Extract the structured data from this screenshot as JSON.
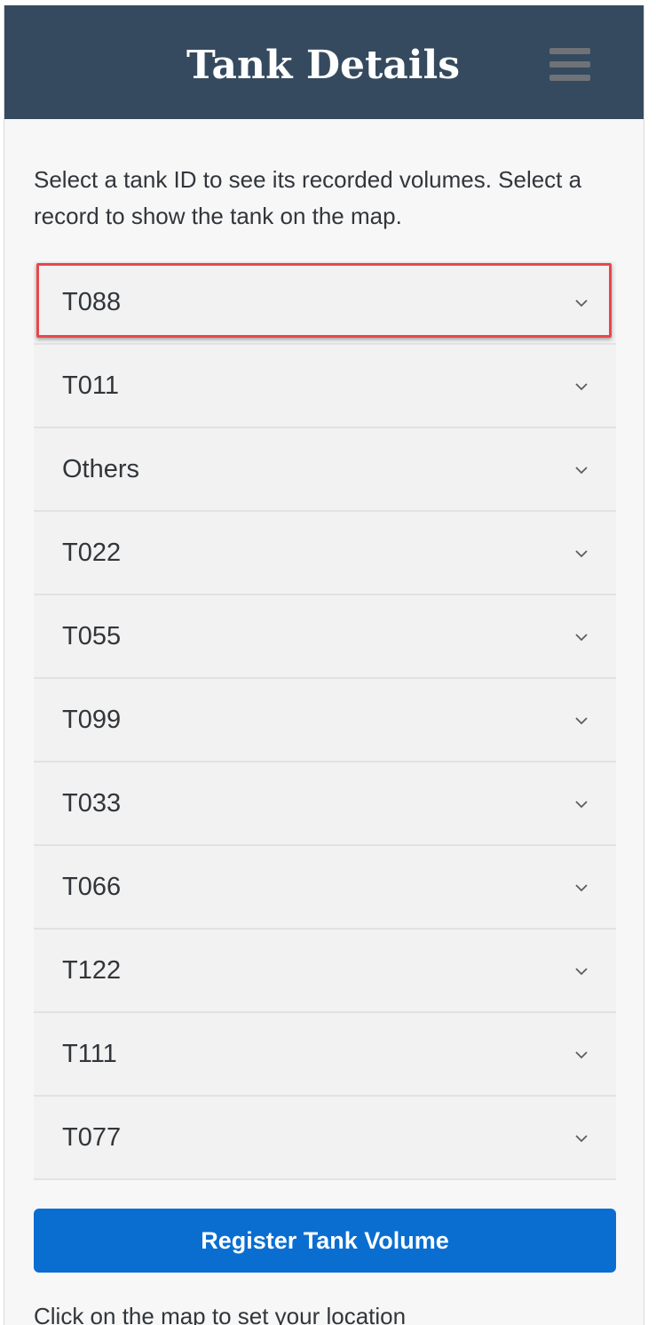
{
  "header": {
    "title": "Tank Details",
    "menu_icon": "hamburger-menu-icon"
  },
  "intro": {
    "text": "Select a tank ID to see its recorded volumes. Select a record to show the tank on the map."
  },
  "tank_list": {
    "items": [
      {
        "label": "T088",
        "expanded": false,
        "highlighted": true
      },
      {
        "label": "T011",
        "expanded": false
      },
      {
        "label": "Others",
        "expanded": false
      },
      {
        "label": "T022",
        "expanded": false
      },
      {
        "label": "T055",
        "expanded": false
      },
      {
        "label": "T099",
        "expanded": false
      },
      {
        "label": "T033",
        "expanded": false
      },
      {
        "label": "T066",
        "expanded": false
      },
      {
        "label": "T122",
        "expanded": false
      },
      {
        "label": "T111",
        "expanded": false
      },
      {
        "label": "T077",
        "expanded": false
      }
    ],
    "item_icon": "chevron-down-icon"
  },
  "actions": {
    "register_label": "Register Tank Volume"
  },
  "footer": {
    "hint": "Click on the map to set your location"
  },
  "colors": {
    "header_bg": "#354a5f",
    "accent": "#0a6ed1",
    "highlight": "#e8474c",
    "page_bg": "#f7f7f7",
    "item_bg": "#f2f2f2"
  }
}
